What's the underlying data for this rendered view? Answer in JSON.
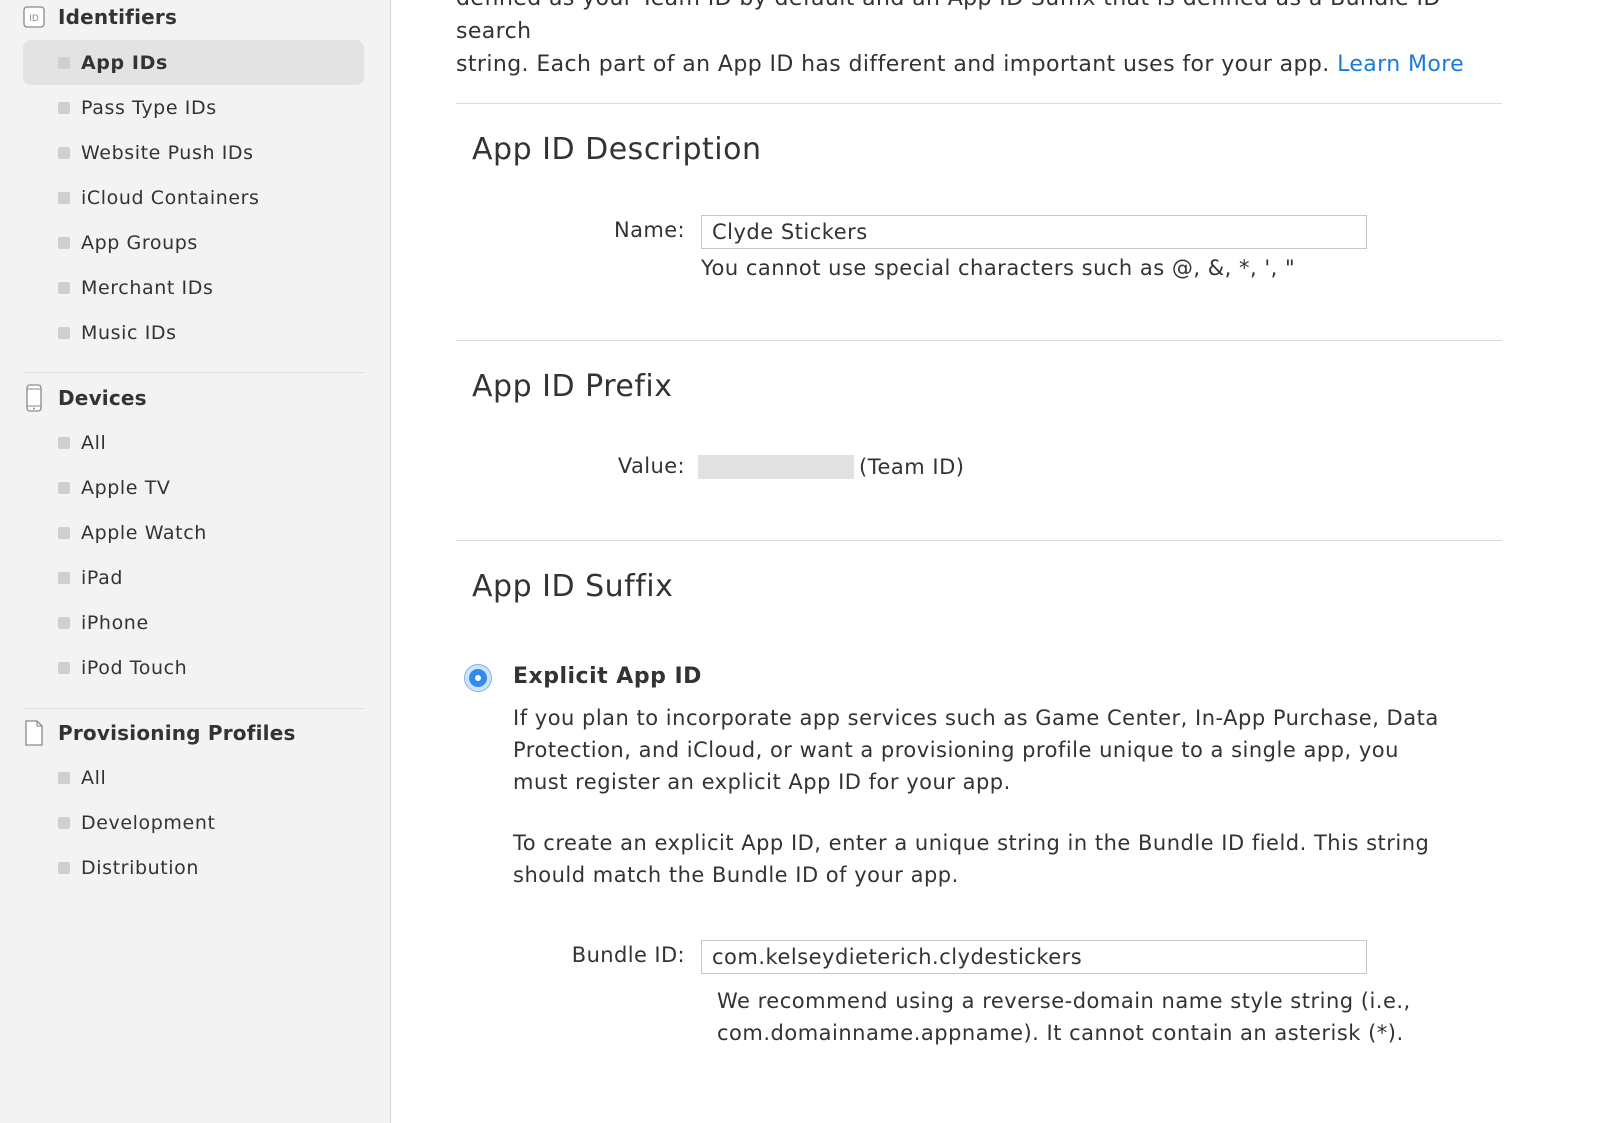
{
  "sidebar": {
    "identifiers": {
      "title": "Identifiers",
      "icon_text": "ID",
      "items": [
        {
          "label": "App IDs",
          "active": true
        },
        {
          "label": "Pass Type IDs"
        },
        {
          "label": "Website Push IDs"
        },
        {
          "label": "iCloud Containers"
        },
        {
          "label": "App Groups"
        },
        {
          "label": "Merchant IDs"
        },
        {
          "label": "Music IDs"
        }
      ]
    },
    "devices": {
      "title": "Devices",
      "items": [
        {
          "label": "All"
        },
        {
          "label": "Apple TV"
        },
        {
          "label": "Apple Watch"
        },
        {
          "label": "iPad"
        },
        {
          "label": "iPhone"
        },
        {
          "label": "iPod Touch"
        }
      ]
    },
    "profiles": {
      "title": "Provisioning Profiles",
      "items": [
        {
          "label": "All"
        },
        {
          "label": "Development"
        },
        {
          "label": "Distribution"
        }
      ]
    }
  },
  "main": {
    "intro_line1": "defined as your Team ID by default and an App ID Suffix that is defined as a Bundle ID search",
    "intro_line2": "string. Each part of an App ID has different and important uses for your app.",
    "learn_more": "Learn More",
    "description": {
      "heading": "App ID Description",
      "name_label": "Name:",
      "name_value": "Clyde Stickers",
      "name_hint": "You cannot use special characters such as @, &, *, ', \""
    },
    "prefix": {
      "heading": "App ID Prefix",
      "value_label": "Value:",
      "value_suffix": "(Team ID)"
    },
    "suffix": {
      "heading": "App ID Suffix",
      "option_title": "Explicit App ID",
      "option_selected": true,
      "para1": "If you plan to incorporate app services such as Game Center, In-App Purchase, Data Protection, and iCloud, or want a provisioning profile unique to a single app, you must register an explicit App ID for your app.",
      "para2": "To create an explicit App ID, enter a unique string in the Bundle ID field. This string should match the Bundle ID of your app.",
      "bundle_label": "Bundle ID:",
      "bundle_value": "com.kelseydieterich.clydestickers",
      "bundle_hint": "We recommend using a reverse-domain name style string (i.e., com.domainname.appname). It cannot contain an asterisk (*)."
    }
  },
  "colors": {
    "link": "#1b7bd9",
    "radio_fill": "#2f8bf0",
    "active_item_bg": "#e3e3e3",
    "sidebar_bg": "#f3f3f3"
  }
}
